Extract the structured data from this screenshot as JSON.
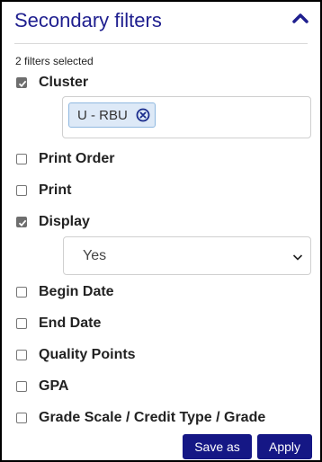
{
  "panel": {
    "title": "Secondary filters",
    "selected_count": "2 filters selected"
  },
  "filters": [
    {
      "label": "Cluster",
      "checked": true
    },
    {
      "label": "Print Order",
      "checked": false
    },
    {
      "label": "Print",
      "checked": false
    },
    {
      "label": "Display",
      "checked": true
    },
    {
      "label": "Begin Date",
      "checked": false
    },
    {
      "label": "End Date",
      "checked": false
    },
    {
      "label": "Quality Points",
      "checked": false
    },
    {
      "label": "GPA",
      "checked": false
    },
    {
      "label": "Grade Scale / Credit Type / Grade",
      "checked": false
    }
  ],
  "cluster": {
    "tags": [
      {
        "label": "U - RBU"
      }
    ]
  },
  "display": {
    "selected": "Yes"
  },
  "buttons": {
    "save_as": "Save as",
    "apply": "Apply"
  },
  "colors": {
    "title": "#1f1f8f",
    "button": "#151785",
    "tag_bg": "#dde9f7",
    "tag_border": "#8fb8e0",
    "checkbox_checked": "#6e6e6e"
  },
  "icons": {
    "collapse": "chevron-up-icon",
    "tag_remove": "close-circle-icon",
    "select": "chevron-down-icon",
    "check": "check-icon"
  }
}
